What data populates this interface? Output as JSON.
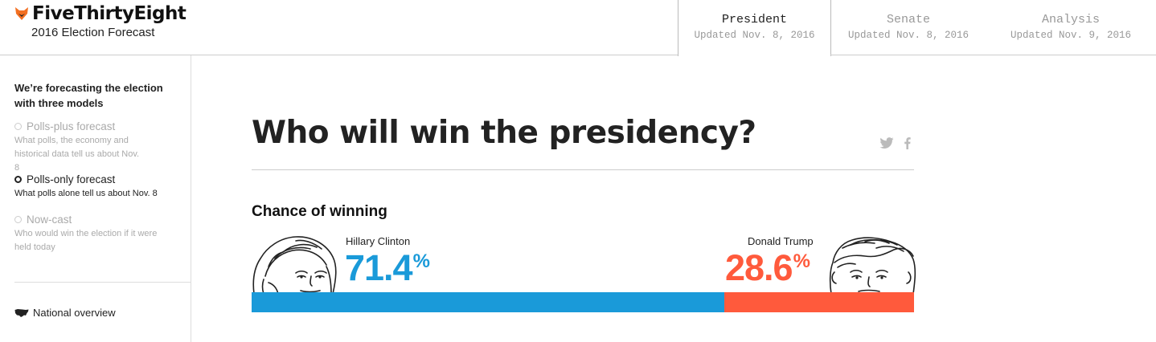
{
  "brand": {
    "name": "FiveThirtyEight",
    "subtitle": "2016 Election Forecast"
  },
  "tabs": [
    {
      "label": "President",
      "updated": "Updated Nov. 8, 2016",
      "active": true
    },
    {
      "label": "Senate",
      "updated": "Updated Nov. 8, 2016",
      "active": false
    },
    {
      "label": "Analysis",
      "updated": "Updated Nov. 9, 2016",
      "active": false
    }
  ],
  "sidebar": {
    "intro": "We’re forecasting the election with three models",
    "models": [
      {
        "title": "Polls-plus forecast",
        "description": "What polls, the economy and historical data tell us about Nov. 8",
        "selected": false
      },
      {
        "title": "Polls-only forecast",
        "description": "What polls alone tell us about Nov. 8",
        "selected": true
      },
      {
        "title": "Now-cast",
        "description": "Who would win the election if it were held today",
        "selected": false
      }
    ],
    "national_overview": "National overview"
  },
  "main": {
    "title": "Who will win the presidency?",
    "chance_label": "Chance of winning",
    "candidates": [
      {
        "name": "Hillary Clinton",
        "value": "71.4",
        "unit": "%",
        "share": 71.4,
        "color": "#1a9ad9"
      },
      {
        "name": "Donald Trump",
        "value": "28.6",
        "unit": "%",
        "share": 28.6,
        "color": "#ff5a3c"
      }
    ]
  },
  "colors": {
    "clinton": "#1a9ad9",
    "trump": "#ff5a3c",
    "brand_fox": "#f36f21"
  },
  "icons": [
    "fox-logo-icon",
    "twitter-icon",
    "facebook-icon",
    "us-map-icon"
  ]
}
